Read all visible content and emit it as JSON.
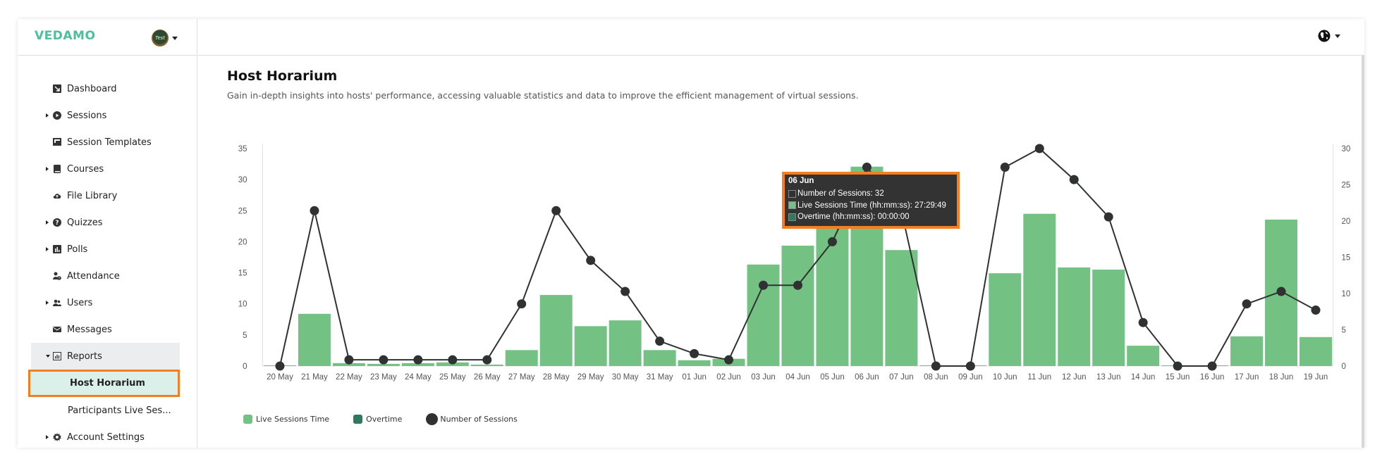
{
  "app": {
    "logo": "VEDAMO",
    "avatar_text": "Test"
  },
  "sidebar": {
    "items": [
      {
        "label": "Dashboard",
        "icon": "dashboard-icon",
        "expandable": false
      },
      {
        "label": "Sessions",
        "icon": "play-circle-icon",
        "expandable": true
      },
      {
        "label": "Session Templates",
        "icon": "template-icon",
        "expandable": false
      },
      {
        "label": "Courses",
        "icon": "book-icon",
        "expandable": true
      },
      {
        "label": "File Library",
        "icon": "cloud-upload-icon",
        "expandable": false
      },
      {
        "label": "Quizzes",
        "icon": "question-circle-icon",
        "expandable": true
      },
      {
        "label": "Polls",
        "icon": "poll-chart-icon",
        "expandable": true
      },
      {
        "label": "Attendance",
        "icon": "user-clock-icon",
        "expandable": false
      },
      {
        "label": "Users",
        "icon": "users-icon",
        "expandable": true
      },
      {
        "label": "Messages",
        "icon": "envelope-icon",
        "expandable": false
      },
      {
        "label": "Reports",
        "icon": "report-chart-icon",
        "expandable": true,
        "open": true
      },
      {
        "label": "Host Horarium",
        "sub": true,
        "active": true
      },
      {
        "label": "Participants Live Ses...",
        "sub": true
      },
      {
        "label": "Account Settings",
        "icon": "gear-icon",
        "expandable": true
      }
    ]
  },
  "page": {
    "title": "Host Horarium",
    "description": "Gain in-depth insights into hosts' performance, accessing valuable statistics and data to improve the efficient management of virtual sessions."
  },
  "colors": {
    "live": "#74c283",
    "overtime": "#2d7a5f",
    "sessions": "#2f3133",
    "highlight": "#f37f22",
    "brand": "#4cbf9b"
  },
  "chart_data": {
    "type": "bar",
    "title": "",
    "categories": [
      "20 May",
      "21 May",
      "22 May",
      "23 May",
      "24 May",
      "25 May",
      "26 May",
      "27 May",
      "28 May",
      "29 May",
      "30 May",
      "31 May",
      "01 Jun",
      "02 Jun",
      "03 Jun",
      "04 Jun",
      "05 Jun",
      "06 Jun",
      "07 Jun",
      "08 Jun",
      "09 Jun",
      "10 Jun",
      "11 Jun",
      "12 Jun",
      "13 Jun",
      "14 Jun",
      "15 Jun",
      "16 Jun",
      "17 Jun",
      "18 Jun",
      "19 Jun"
    ],
    "series": [
      {
        "name": "Live Sessions Time",
        "type": "bar",
        "axis": "right",
        "unit": "hours",
        "values": [
          0.1,
          7.2,
          0.4,
          0.3,
          0.4,
          0.5,
          0.2,
          2.2,
          9.8,
          5.5,
          6.3,
          2.2,
          0.8,
          1.0,
          14.0,
          16.6,
          22.0,
          27.5,
          16.0,
          0.1,
          0.1,
          12.8,
          21.0,
          13.6,
          13.3,
          2.8,
          0.1,
          0.1,
          4.1,
          20.2,
          4.0
        ]
      },
      {
        "name": "Overtime",
        "type": "bar",
        "axis": "right",
        "unit": "hours",
        "values": [
          0,
          0,
          0,
          0,
          0,
          0,
          0,
          0,
          0,
          0,
          0,
          0,
          0,
          0,
          0,
          0,
          0,
          0,
          0,
          0,
          0,
          0,
          0,
          0,
          0,
          0,
          0,
          0,
          0,
          0,
          0
        ]
      },
      {
        "name": "Number of Sessions",
        "type": "line",
        "axis": "left",
        "values": [
          0,
          25,
          1,
          1,
          1,
          1,
          1,
          10,
          25,
          17,
          12,
          4,
          2,
          1,
          13,
          13,
          20,
          32,
          25,
          0,
          0,
          32,
          35,
          30,
          24,
          7,
          0,
          0,
          10,
          12,
          9
        ]
      }
    ],
    "left_axis": {
      "ylim": [
        0,
        35
      ],
      "ticks": [
        "0",
        "5",
        "10",
        "15",
        "20",
        "25",
        "30",
        "35"
      ]
    },
    "right_axis": {
      "ylim": [
        0,
        30
      ],
      "ticks": [
        "0",
        "5",
        "10",
        "15",
        "20",
        "25",
        "30"
      ]
    },
    "legend": {
      "placement": "bottom-left",
      "entries": [
        "Live Sessions Time",
        "Overtime",
        "Number of Sessions"
      ]
    },
    "grid": false,
    "tooltip": {
      "category": "06 Jun",
      "rows": [
        {
          "label": "Number of Sessions: 32",
          "swatch": "sessions"
        },
        {
          "label": "Live Sessions Time (hh:mm:ss): 27:29:49",
          "swatch": "live"
        },
        {
          "label": "Overtime (hh:mm:ss): 00:00:00",
          "swatch": "overtime"
        }
      ]
    }
  }
}
